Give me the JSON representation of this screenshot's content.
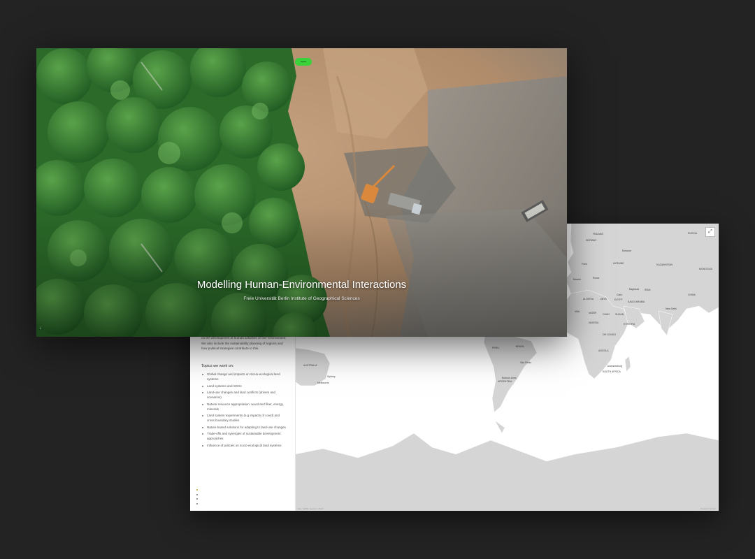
{
  "hero": {
    "title": "Modelling Human-Environmental Interactions",
    "subtitle": "Freie Universität Berlin Institute of Geographical Sciences",
    "scroll_icon": "arrow-down-icon",
    "colors": {
      "forest": "#2f6e2a",
      "soil": "#b48f6e",
      "ash": "#8f8f8b"
    }
  },
  "side_panel": {
    "intro_text": "on the development of human activities on the environment. We also include the sustainability planning of regions and how political strategies contribute to this.",
    "topics_heading": "Topics we work on:",
    "topics": [
      "Global change and impacts on Socio-ecological land systems",
      "Land systems and SDGs",
      "Land-use changes and land conflicts (drivers and scenarios)",
      "Natural resource appropriation: wood and fiber, energy, minerals",
      "Land system experiments (e.g impacts of covid) and cross boundary studies",
      "Nature based solutions for adapting to land-use changes",
      "Trade-offs and synergies of sustainable development approaches",
      "Influence of policies on socio-ecological land systems"
    ]
  },
  "map": {
    "labels": {
      "finland": "FINLAND",
      "norway": "NORWAY",
      "russia": "RUSSIA",
      "moscow": "Moscow",
      "kazakhstan": "KAZAKHSTAN",
      "mongolia": "MONGOLIA",
      "ukraine": "UKRAINE",
      "paris": "Paris",
      "madrid": "Madrid",
      "rome": "Rome",
      "algeria": "ALGERIA",
      "libya": "LIBYA",
      "egypt": "EGYPT",
      "cairo": "Cairo",
      "iran": "IRAN",
      "baghdad": "Baghdad",
      "saudi_arabia": "SAUDI ARABIA",
      "china": "CHINA",
      "new_delhi": "New Delhi",
      "mali": "MALI",
      "niger": "NIGER",
      "chad": "CHAD",
      "sudan": "SUDAN",
      "nigeria": "NIGERIA",
      "ethiopia": "ETHIOPIA",
      "dr_congo": "DR CONGO",
      "angola": "ANGOLA",
      "south_africa": "SOUTH AFRICA",
      "johannesburg": "Johannesburg",
      "peru": "PERU",
      "brazil": "BRAZIL",
      "sao_paulo": "Sao Paulo",
      "buenos_aires": "Buenos Aires",
      "argentina": "ARGENTINA",
      "australia": "AUSTRALIA",
      "sydney": "Sydney",
      "melbourne": "Melbourne"
    },
    "expand_icon": "expand-icon",
    "attribution_left": "Esri, HERE, Garmin, USGS",
    "attribution_right": "Powered by Esri",
    "colors": {
      "land": "#d4d4d4",
      "water": "#ffffff",
      "border": "#ffffff"
    }
  }
}
